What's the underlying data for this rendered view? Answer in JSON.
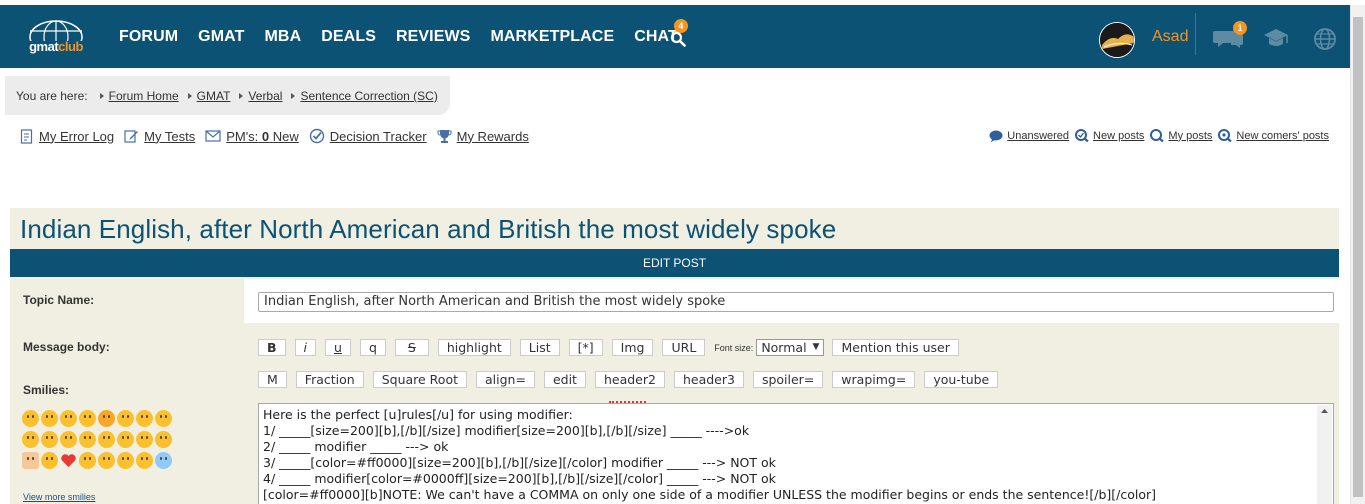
{
  "header": {
    "logo_text_a": "gmat",
    "logo_text_b": "club",
    "nav": [
      {
        "label": "FORUM"
      },
      {
        "label": "GMAT"
      },
      {
        "label": "MBA"
      },
      {
        "label": "DEALS"
      },
      {
        "label": "REVIEWS"
      },
      {
        "label": "MARKETPLACE"
      },
      {
        "label": "CHAT",
        "badge": "4"
      }
    ],
    "user_name": "Asad",
    "messages_badge": "1",
    "brand_color": "#0b5275",
    "accent_color": "#f7941d"
  },
  "breadcrumb": {
    "prefix": "You are here:",
    "items": [
      "Forum Home",
      "GMAT",
      "Verbal",
      "Sentence Correction (SC)"
    ]
  },
  "tools": {
    "error_log": "My Error Log",
    "tests": "My Tests",
    "pms_label": "PM's:",
    "pms_count": "0",
    "pms_new": "New",
    "decision_tracker": "Decision Tracker",
    "rewards": "My Rewards"
  },
  "right_links": {
    "unanswered": "Unanswered",
    "new_posts": "New posts",
    "my_posts": "My posts",
    "new_comers": "New comers' posts"
  },
  "post": {
    "title": "Indian English, after North American and British the most widely spoke",
    "edit_bar": "EDIT POST"
  },
  "form": {
    "topic_label": "Topic Name:",
    "topic_value": "Indian English, after North American and British the most widely spoke",
    "message_label": "Message body:",
    "smilies_label": "Smilies:",
    "view_more": "View more smilies",
    "toolbar1": {
      "b": "B",
      "i": "i",
      "u": "u",
      "q": "q",
      "s": "S",
      "highlight": "highlight",
      "list": "List",
      "star": "[*]",
      "img": "Img",
      "url": "URL",
      "font_size_label": "Font size:",
      "font_size_value": "Normal",
      "mention": "Mention this user"
    },
    "toolbar2": {
      "m": "M",
      "fraction": "Fraction",
      "sqrt": "Square Root",
      "align": "align=",
      "edit": "edit",
      "header2": "header2",
      "header3": "header3",
      "spoiler": "spoiler=",
      "wrapimg": "wrapimg=",
      "youtube": "you-tube"
    },
    "message_lines": [
      "Here is the perfect [u]rules[/u] for using modifier:",
      "1/ _____[size=200][b],[/b][/size] modifier[size=200][b],[/b][/size] _____ ---->ok",
      "2/ _____ modifier _____ ---> ok",
      "3/ _____[color=#ff0000][size=200][b],[/b][/size][/color] modifier _____ ---> NOT ok",
      "4/ _____ modifier[color=#0000ff][size=200][b],[/b][/size][/color] _____ ---> NOT ok",
      "[color=#ff0000][b]NOTE: We can't have a COMMA on only one side of a modifier UNLESS the modifier begins or ends the sentence![/b][/color]"
    ]
  }
}
